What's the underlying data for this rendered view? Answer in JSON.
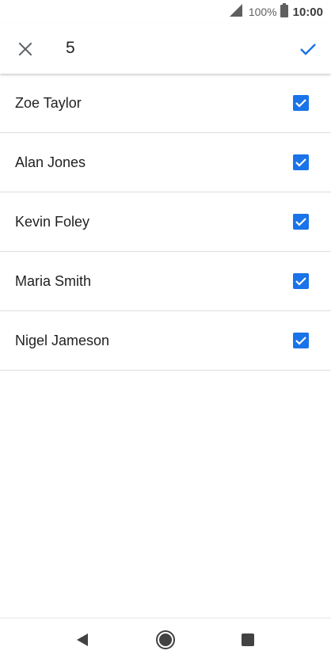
{
  "status_bar": {
    "battery_percent": "100%",
    "time": "10:00",
    "icons": [
      "signal-icon",
      "battery-icon"
    ]
  },
  "app_bar": {
    "selected_count": "5",
    "close_icon": "close-icon",
    "confirm_icon": "check-icon"
  },
  "contacts": [
    {
      "name": "Zoe Taylor",
      "checked": true
    },
    {
      "name": "Alan Jones",
      "checked": true
    },
    {
      "name": "Kevin Foley",
      "checked": true
    },
    {
      "name": "Maria Smith",
      "checked": true
    },
    {
      "name": "Nigel Jameson",
      "checked": true
    }
  ],
  "nav_bar": {
    "icons": [
      "back-icon",
      "home-icon",
      "recents-icon"
    ]
  },
  "colors": {
    "accent": "#1a73e8",
    "text_primary": "#212121",
    "divider": "#dedede"
  }
}
